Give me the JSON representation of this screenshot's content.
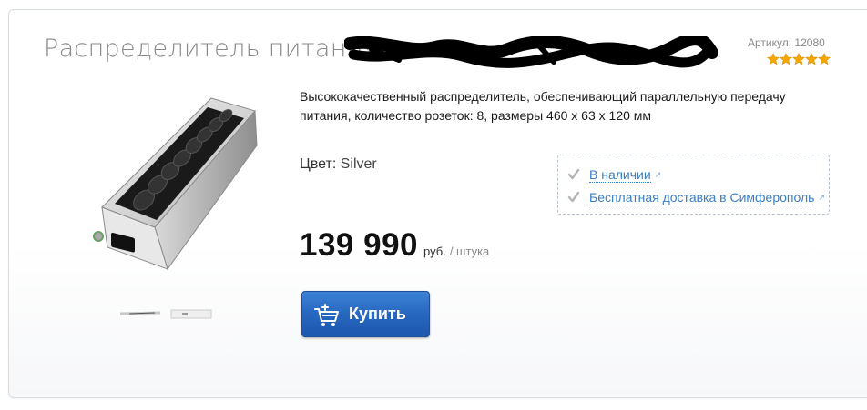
{
  "product": {
    "title": "Распределитель питания",
    "sku_label": "Артикул:",
    "sku_value": "12080",
    "rating_stars": 5,
    "description": "Высококачественный распределитель, обеспечивающий параллельную передачу питания, количество розеток: 8, размеры 460 х 63 х 120 мм",
    "color_label": "Цвет:",
    "color_value": "Silver",
    "price": "139 990",
    "currency": "руб.",
    "per_unit": "/ штука"
  },
  "availability": {
    "in_stock": "В наличии",
    "delivery": "Бесплатная доставка в Симферополь"
  },
  "actions": {
    "buy_label": "Купить"
  },
  "colors": {
    "link": "#3a7fc3",
    "button": "#2767c0",
    "star": "#f5a800",
    "check": "#b5b5b5"
  }
}
